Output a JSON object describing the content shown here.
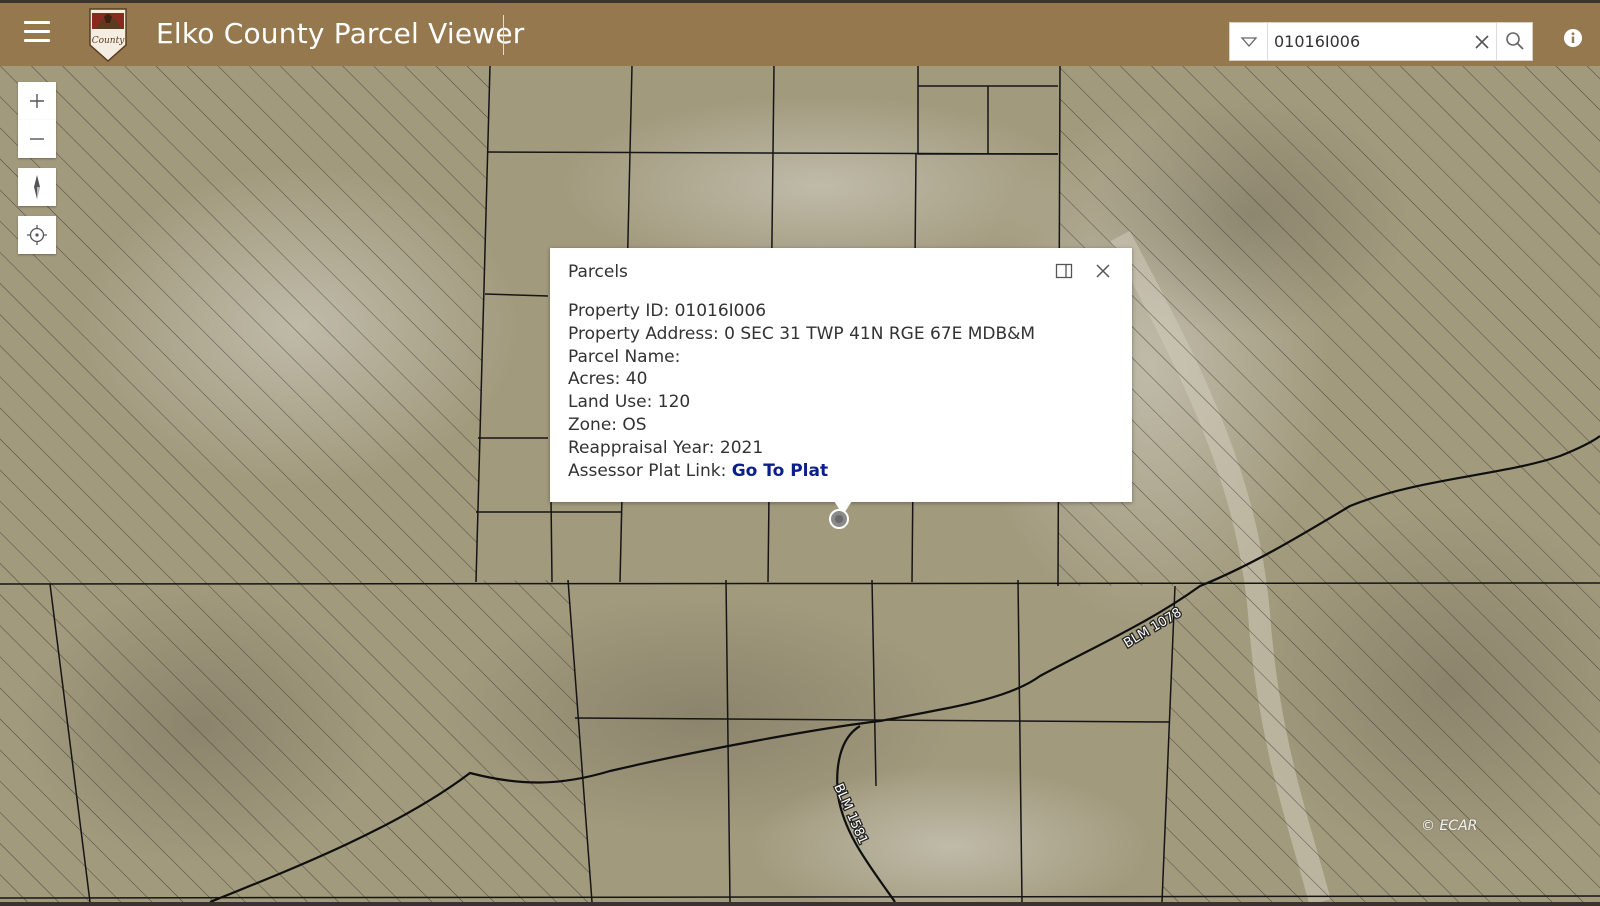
{
  "header": {
    "title": "Elko County Parcel Viewer",
    "logo_text": "County",
    "background": "#96784f"
  },
  "search": {
    "value": "01016I006",
    "filter_icon": "chevron-down-icon",
    "clear_icon": "close-icon",
    "search_icon": "search-icon"
  },
  "map": {
    "zoom_in_icon": "plus-icon",
    "zoom_out_icon": "minus-icon",
    "compass_icon": "compass-icon",
    "locate_icon": "locate-icon",
    "road_labels": [
      "BLM 1078",
      "BLM 1581"
    ],
    "attribution": "© ECAR"
  },
  "popup": {
    "title": "Parcels",
    "fields": [
      {
        "label": "Property ID: ",
        "value": "01016I006"
      },
      {
        "label": "Property Address: ",
        "value": "0 SEC 31 TWP 41N RGE 67E MDB&M"
      },
      {
        "label": "Parcel Name: ",
        "value": ""
      },
      {
        "label": "Acres: ",
        "value": "40"
      },
      {
        "label": "Land Use: ",
        "value": "120"
      },
      {
        "label": "Zone: ",
        "value": "OS"
      },
      {
        "label": "Reappraisal Year: ",
        "value": "2021"
      },
      {
        "label": "Assessor Plat Link: ",
        "value": "Go To Plat"
      }
    ],
    "link_color": "#0a1e8c"
  }
}
